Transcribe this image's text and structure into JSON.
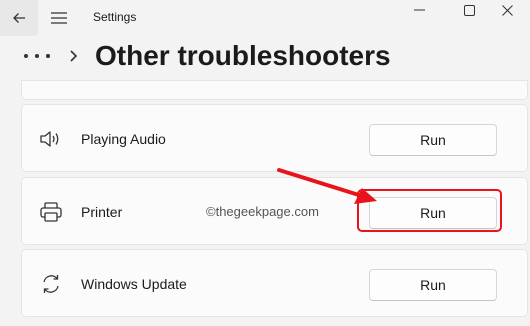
{
  "titlebar": {
    "app_title": "Settings"
  },
  "header": {
    "page_title": "Other troubleshooters"
  },
  "troubleshooters": [
    {
      "label": "Playing Audio",
      "button": "Run",
      "icon": "speaker-icon"
    },
    {
      "label": "Printer",
      "button": "Run",
      "icon": "printer-icon"
    },
    {
      "label": "Windows Update",
      "button": "Run",
      "icon": "refresh-icon"
    }
  ],
  "watermark": "©thegeekpage.com",
  "annotation": {
    "color": "#e8141c"
  }
}
